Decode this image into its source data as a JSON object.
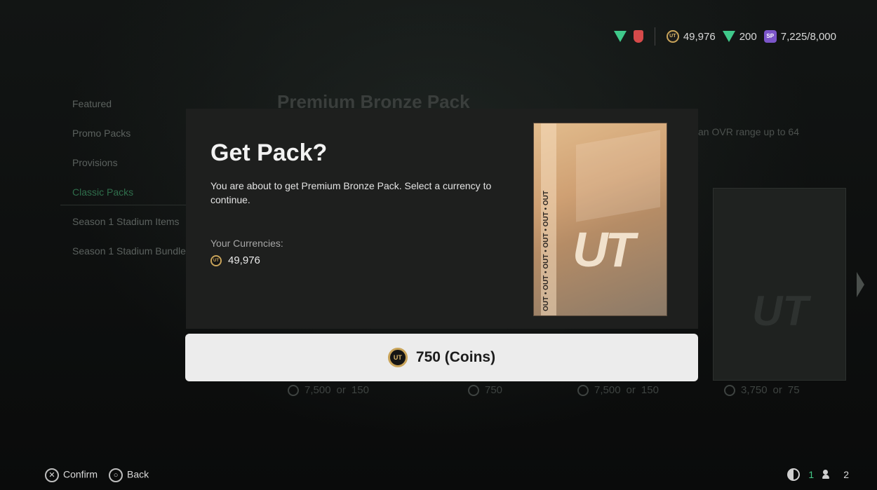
{
  "topbar": {
    "coins": "49,976",
    "fifa_points": "200",
    "season_points": "7,225/8,000",
    "icons": [
      "fut-logo-icon",
      "club-badge-icon",
      "coin-icon",
      "fifa-points-icon",
      "season-points-icon"
    ],
    "coin_icon_text": "UT",
    "sp_icon_text": "SP"
  },
  "background": {
    "menu": [
      "Featured",
      "Promo Packs",
      "Provisions",
      "Classic Packs",
      "Season 1 Stadium Items",
      "Season 1 Stadium Bundles"
    ],
    "active_menu": "Classic Packs",
    "title": "Premium Bronze Pack",
    "description": "an OVR range up to 64",
    "prices": [
      {
        "coins": "7,500",
        "or": "or",
        "points": "150"
      },
      {
        "coins": "750"
      },
      {
        "coins": "7,500",
        "or": "or",
        "points": "150"
      },
      {
        "coins": "3,750",
        "or": "or",
        "points": "75"
      }
    ],
    "pack_label": "UT"
  },
  "modal": {
    "title": "Get Pack?",
    "message": "You are about to get Premium Bronze Pack. Select a currency to continue.",
    "currencies_label": "Your Currencies:",
    "currencies_value": "49,976",
    "pack_logo": "UT",
    "pack_strip": "OUT • OUT • OUT • OUT • OUT • OUT"
  },
  "cta": {
    "label": "750 (Coins)"
  },
  "footer": {
    "confirm": "Confirm",
    "back": "Back",
    "confirm_glyph": "✕",
    "back_glyph": "○",
    "count_a": "1",
    "count_b": "2"
  },
  "colors": {
    "accent_green": "#44c987",
    "coin_gold": "#c9a45a",
    "modal_bg": "#1e1f1e",
    "cta_bg": "#ececec"
  }
}
